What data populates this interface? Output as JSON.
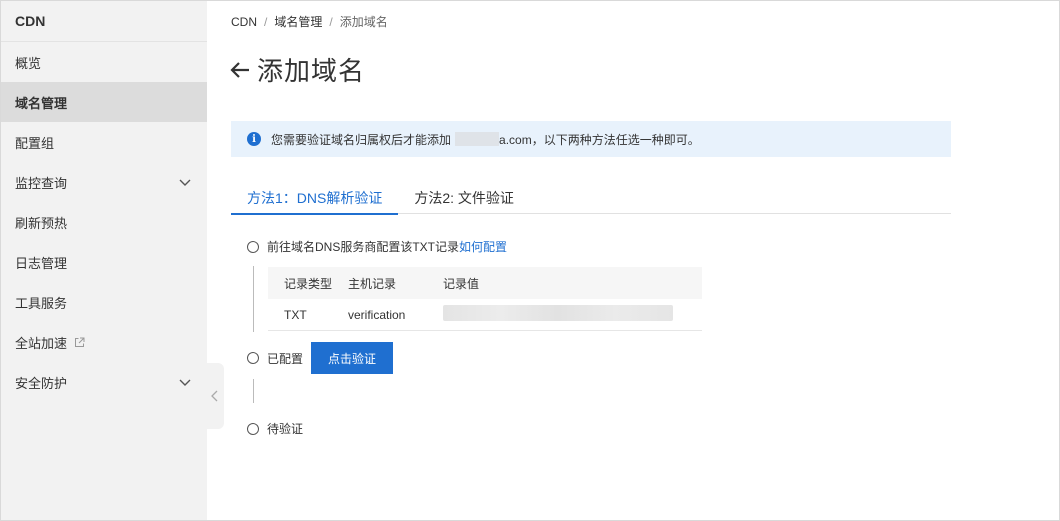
{
  "sidebar": {
    "title": "CDN",
    "items": [
      {
        "label": "概览"
      },
      {
        "label": "域名管理"
      },
      {
        "label": "配置组"
      },
      {
        "label": "监控查询"
      },
      {
        "label": "刷新预热"
      },
      {
        "label": "日志管理"
      },
      {
        "label": "工具服务"
      },
      {
        "label": "全站加速"
      },
      {
        "label": "安全防护"
      }
    ]
  },
  "breadcrumb": [
    "CDN",
    "域名管理",
    "添加域名"
  ],
  "page_title": "添加域名",
  "notice": {
    "prefix": "您需要验证域名归属权后才能添加",
    "suffix": "a.com，以下两种方法任选一种即可。"
  },
  "tabs": [
    "方法1：DNS解析验证",
    "方法2: 文件验证"
  ],
  "steps": {
    "step1_text": "前往域名DNS服务商配置该TXT记录",
    "step1_link": "如何配置",
    "step2_text": "已配置",
    "verify_button": "点击验证",
    "step3_text": "待验证"
  },
  "record_table": {
    "headers": [
      "记录类型",
      "主机记录",
      "记录值"
    ],
    "row": {
      "type": "TXT",
      "host": "verification"
    }
  },
  "colors": {
    "accent": "#1f6fd0",
    "notice_bg": "#e8f2fc",
    "sidebar_bg": "#f2f2f2"
  }
}
